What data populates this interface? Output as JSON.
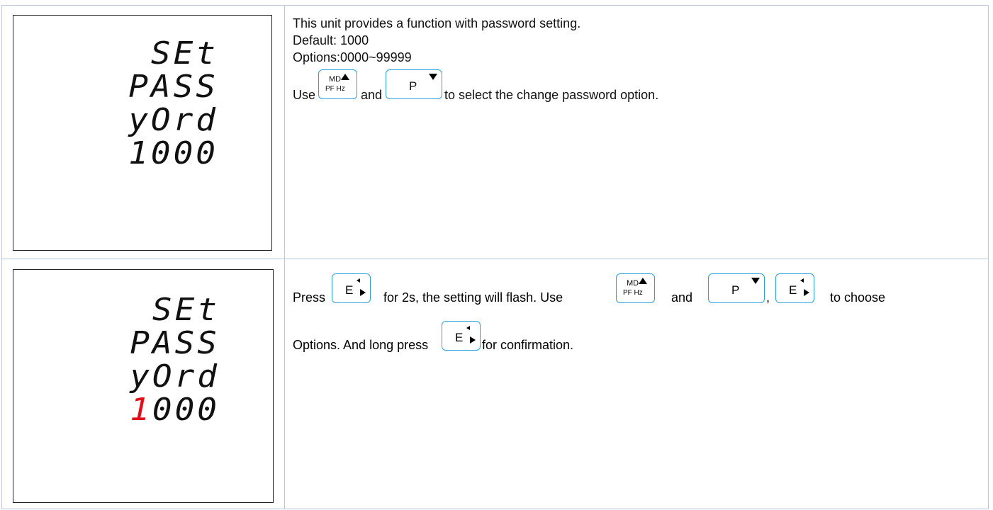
{
  "row1": {
    "display": {
      "line1": "SEt",
      "line2": "PASS",
      "line3": "уОrd",
      "line4": "1000"
    },
    "text": {
      "line1": "This unit provides a function with password setting.",
      "line2": "Default: 1000",
      "line3": "Options:0000~99999",
      "use_prefix": "Use",
      "and": "and",
      "use_suffix": "to select the change password option."
    }
  },
  "row2": {
    "display": {
      "line1": "SEt",
      "line2": "PASS",
      "line3": "уОrd",
      "line4_flash": "1",
      "line4_rest": "000"
    },
    "text": {
      "press": "Press",
      "mid": "for 2s, the setting will flash. Use",
      "and": "and",
      "comma": ",",
      "choose": "to choose",
      "options": "Options.  And long press",
      "confirm": "for confirmation."
    }
  },
  "keys": {
    "md_top": "MD",
    "md_bottom": "PF Hz",
    "p": "P",
    "e": "E"
  }
}
